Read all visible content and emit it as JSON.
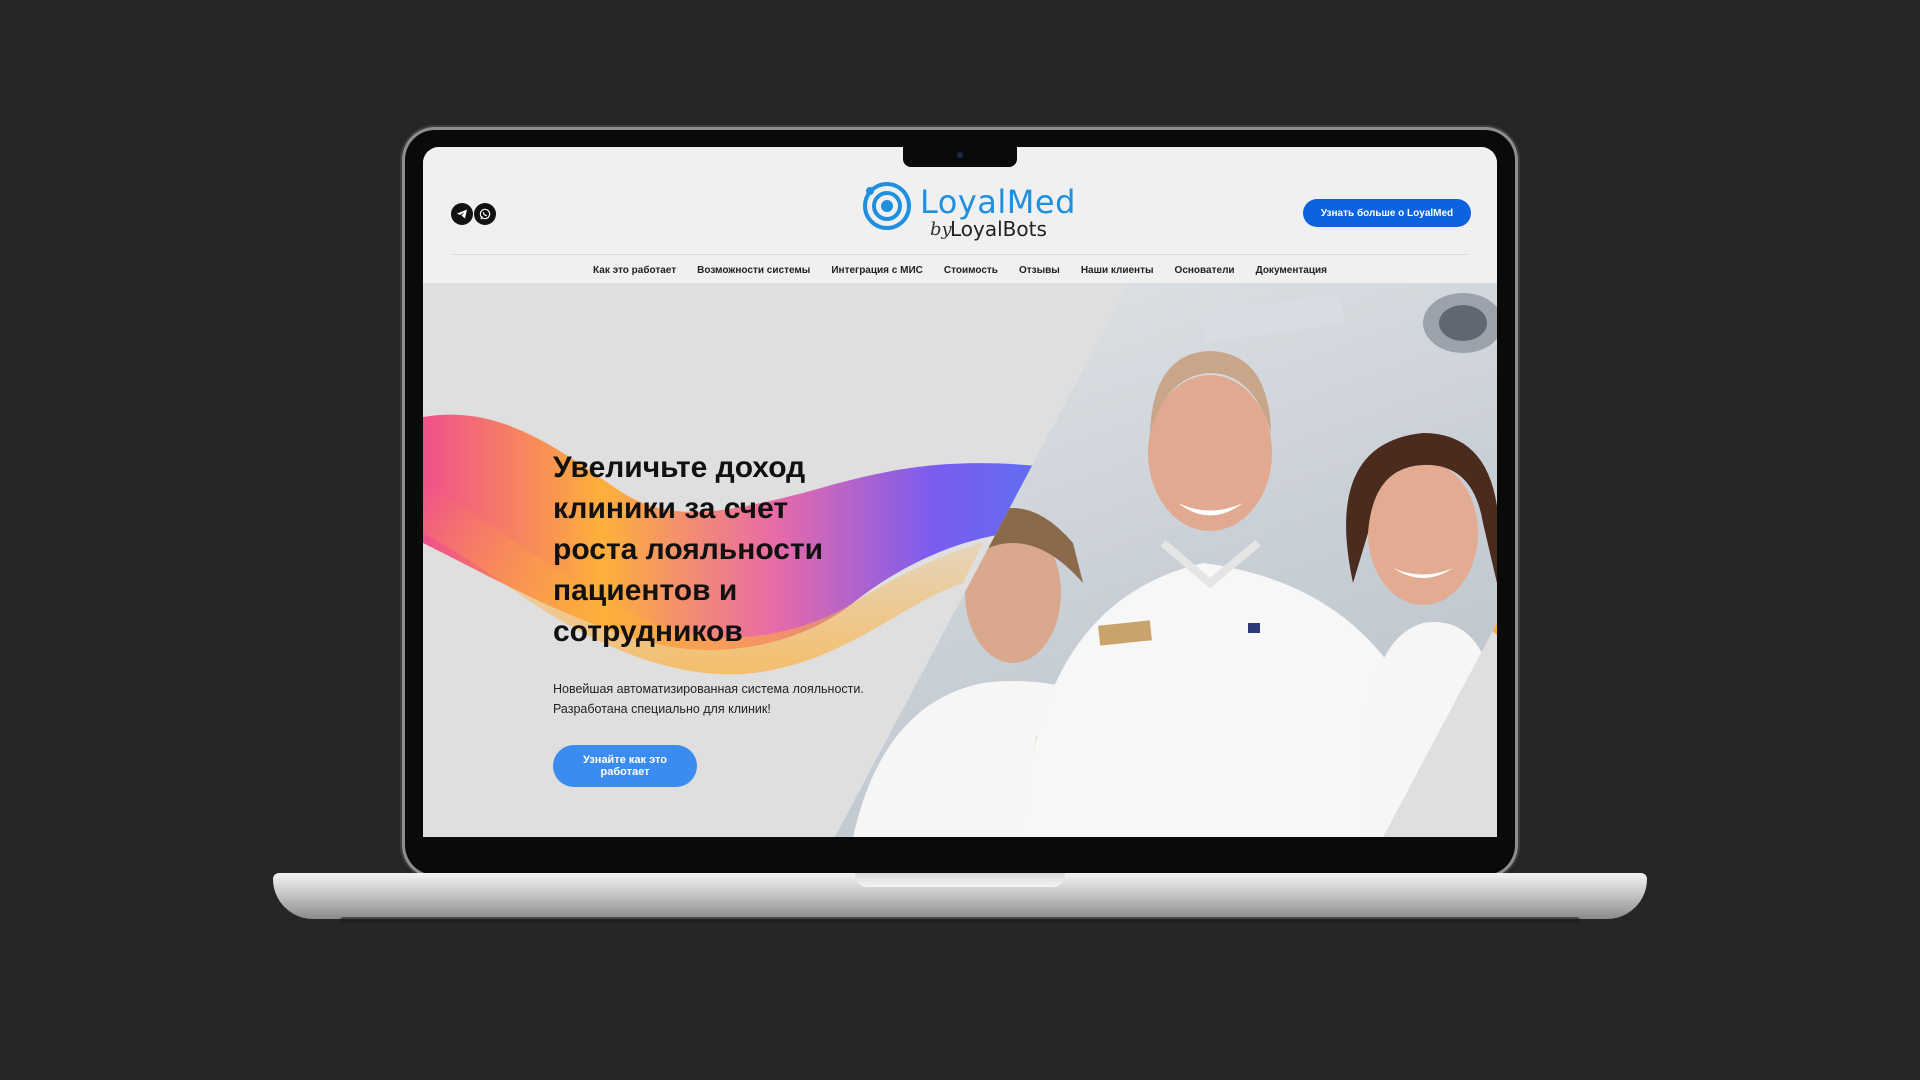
{
  "header": {
    "logo": {
      "name": "LoyalMed",
      "by": "by",
      "company": "LoyalBots"
    },
    "cta_label": "Узнать больше о LoyalMed",
    "social_icons": [
      "telegram-icon",
      "whatsapp-icon"
    ]
  },
  "nav": {
    "items": [
      {
        "label": "Как это работает"
      },
      {
        "label": "Возможности системы"
      },
      {
        "label": "Интеграция с МИС"
      },
      {
        "label": "Стоимость"
      },
      {
        "label": "Отзывы"
      },
      {
        "label": "Наши клиенты"
      },
      {
        "label": "Основатели"
      },
      {
        "label": "Документация"
      }
    ]
  },
  "hero": {
    "title": "Увеличьте доход клиники за счет роста лояльности пациентов и сотрудников",
    "subtitle_line1": "Новейшая автоматизированная система лояльности.",
    "subtitle_line2": "Разработана специально для клиник!",
    "cta_label": "Узнайте как это работает"
  },
  "colors": {
    "brand": "#1f8fdf",
    "cta_dark": "#0d62e0",
    "cta_light": "#3b8cf0",
    "wave_pink": "#f0508c",
    "wave_orange": "#fdb03a",
    "wave_purple": "#7a5cf0"
  }
}
